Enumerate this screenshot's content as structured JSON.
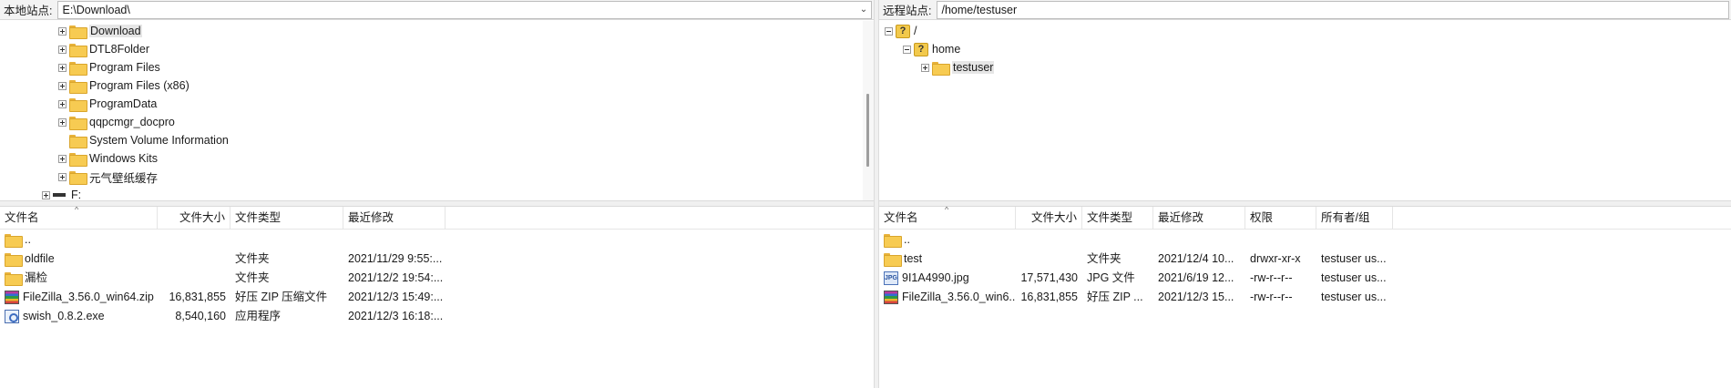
{
  "local": {
    "site_label": "本地站点:",
    "path": "E:\\Download\\",
    "tree": [
      {
        "label": "Download",
        "expander": "plus",
        "selected": true
      },
      {
        "label": "DTL8Folder",
        "expander": "plus"
      },
      {
        "label": "Program Files",
        "expander": "plus"
      },
      {
        "label": "Program Files (x86)",
        "expander": "plus"
      },
      {
        "label": "ProgramData",
        "expander": "plus"
      },
      {
        "label": "qqpcmgr_docpro",
        "expander": "plus"
      },
      {
        "label": "System Volume Information",
        "expander": "none"
      },
      {
        "label": "Windows Kits",
        "expander": "plus"
      },
      {
        "label": "元气壁纸缓存",
        "expander": "plus"
      }
    ],
    "drive": {
      "label": "F:"
    },
    "columns": [
      "文件名",
      "文件大小",
      "文件类型",
      "最近修改"
    ],
    "files": [
      {
        "icon": "folder-icon",
        "name": "..",
        "size": "",
        "type": "",
        "modified": ""
      },
      {
        "icon": "folder-icon",
        "name": "oldfile",
        "size": "",
        "type": "文件夹",
        "modified": "2021/11/29 9:55:..."
      },
      {
        "icon": "folder-icon",
        "name": "漏检",
        "size": "",
        "type": "文件夹",
        "modified": "2021/12/2 19:54:..."
      },
      {
        "icon": "zip-archive-icon",
        "name": "FileZilla_3.56.0_win64.zip",
        "size": "16,831,855",
        "type": "好压 ZIP 压缩文件",
        "modified": "2021/12/3 15:49:..."
      },
      {
        "icon": "executable-icon",
        "name": "swish_0.8.2.exe",
        "size": "8,540,160",
        "type": "应用程序",
        "modified": "2021/12/3 16:18:..."
      }
    ]
  },
  "remote": {
    "site_label": "远程站点:",
    "path": "/home/testuser",
    "tree": [
      {
        "label": "/"
      },
      {
        "label": "home"
      },
      {
        "label": "testuser"
      }
    ],
    "columns": [
      "文件名",
      "文件大小",
      "文件类型",
      "最近修改",
      "权限",
      "所有者/组"
    ],
    "files": [
      {
        "icon": "folder-icon",
        "name": "..",
        "size": "",
        "type": "",
        "modified": "",
        "perms": "",
        "owner": ""
      },
      {
        "icon": "folder-icon",
        "name": "test",
        "size": "",
        "type": "文件夹",
        "modified": "2021/12/4 10...",
        "perms": "drwxr-xr-x",
        "owner": "testuser us..."
      },
      {
        "icon": "jpg-image-icon",
        "name": "9I1A4990.jpg",
        "size": "17,571,430",
        "type": "JPG 文件",
        "modified": "2021/6/19 12...",
        "perms": "-rw-r--r--",
        "owner": "testuser us..."
      },
      {
        "icon": "zip-archive-icon",
        "name": "FileZilla_3.56.0_win6...",
        "size": "16,831,855",
        "type": "好压 ZIP ...",
        "modified": "2021/12/3 15...",
        "perms": "-rw-r--r--",
        "owner": "testuser us..."
      }
    ]
  }
}
